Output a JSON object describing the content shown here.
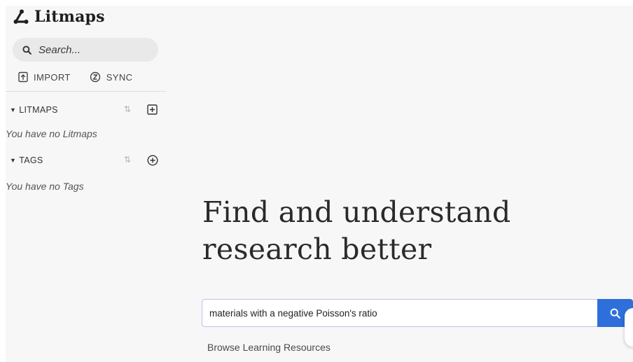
{
  "app": {
    "name": "Litmaps"
  },
  "sidebar": {
    "search_placeholder": "Search...",
    "actions": {
      "import": "IMPORT",
      "sync": "SYNC"
    },
    "litmaps": {
      "title": "LITMAPS",
      "empty": "You have no Litmaps"
    },
    "tags": {
      "title": "TAGS",
      "empty": "You have no Tags"
    }
  },
  "main": {
    "headline_line1": "Find and understand",
    "headline_line2": "research better",
    "search_value": "materials with a negative Poisson's ratio",
    "browse_link": "Browse Learning Resources"
  },
  "colors": {
    "accent": "#2e6fdb",
    "background": "#f7f7f7",
    "search_pill": "#e9e9e9"
  },
  "icons": [
    "litmaps-logo-icon",
    "search-icon",
    "import-icon",
    "sync-icon",
    "sort-icon",
    "add-square-icon",
    "add-circle-icon",
    "caret-down-icon"
  ]
}
